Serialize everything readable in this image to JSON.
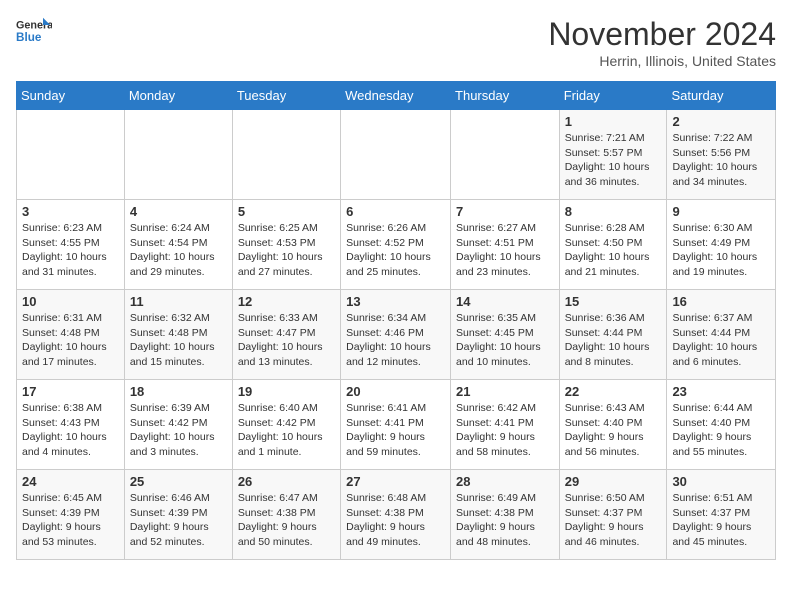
{
  "logo": {
    "line1": "General",
    "line2": "Blue"
  },
  "title": "November 2024",
  "location": "Herrin, Illinois, United States",
  "days_of_week": [
    "Sunday",
    "Monday",
    "Tuesday",
    "Wednesday",
    "Thursday",
    "Friday",
    "Saturday"
  ],
  "weeks": [
    [
      {
        "day": "",
        "info": ""
      },
      {
        "day": "",
        "info": ""
      },
      {
        "day": "",
        "info": ""
      },
      {
        "day": "",
        "info": ""
      },
      {
        "day": "",
        "info": ""
      },
      {
        "day": "1",
        "info": "Sunrise: 7:21 AM\nSunset: 5:57 PM\nDaylight: 10 hours and 36 minutes."
      },
      {
        "day": "2",
        "info": "Sunrise: 7:22 AM\nSunset: 5:56 PM\nDaylight: 10 hours and 34 minutes."
      }
    ],
    [
      {
        "day": "3",
        "info": "Sunrise: 6:23 AM\nSunset: 4:55 PM\nDaylight: 10 hours and 31 minutes."
      },
      {
        "day": "4",
        "info": "Sunrise: 6:24 AM\nSunset: 4:54 PM\nDaylight: 10 hours and 29 minutes."
      },
      {
        "day": "5",
        "info": "Sunrise: 6:25 AM\nSunset: 4:53 PM\nDaylight: 10 hours and 27 minutes."
      },
      {
        "day": "6",
        "info": "Sunrise: 6:26 AM\nSunset: 4:52 PM\nDaylight: 10 hours and 25 minutes."
      },
      {
        "day": "7",
        "info": "Sunrise: 6:27 AM\nSunset: 4:51 PM\nDaylight: 10 hours and 23 minutes."
      },
      {
        "day": "8",
        "info": "Sunrise: 6:28 AM\nSunset: 4:50 PM\nDaylight: 10 hours and 21 minutes."
      },
      {
        "day": "9",
        "info": "Sunrise: 6:30 AM\nSunset: 4:49 PM\nDaylight: 10 hours and 19 minutes."
      }
    ],
    [
      {
        "day": "10",
        "info": "Sunrise: 6:31 AM\nSunset: 4:48 PM\nDaylight: 10 hours and 17 minutes."
      },
      {
        "day": "11",
        "info": "Sunrise: 6:32 AM\nSunset: 4:48 PM\nDaylight: 10 hours and 15 minutes."
      },
      {
        "day": "12",
        "info": "Sunrise: 6:33 AM\nSunset: 4:47 PM\nDaylight: 10 hours and 13 minutes."
      },
      {
        "day": "13",
        "info": "Sunrise: 6:34 AM\nSunset: 4:46 PM\nDaylight: 10 hours and 12 minutes."
      },
      {
        "day": "14",
        "info": "Sunrise: 6:35 AM\nSunset: 4:45 PM\nDaylight: 10 hours and 10 minutes."
      },
      {
        "day": "15",
        "info": "Sunrise: 6:36 AM\nSunset: 4:44 PM\nDaylight: 10 hours and 8 minutes."
      },
      {
        "day": "16",
        "info": "Sunrise: 6:37 AM\nSunset: 4:44 PM\nDaylight: 10 hours and 6 minutes."
      }
    ],
    [
      {
        "day": "17",
        "info": "Sunrise: 6:38 AM\nSunset: 4:43 PM\nDaylight: 10 hours and 4 minutes."
      },
      {
        "day": "18",
        "info": "Sunrise: 6:39 AM\nSunset: 4:42 PM\nDaylight: 10 hours and 3 minutes."
      },
      {
        "day": "19",
        "info": "Sunrise: 6:40 AM\nSunset: 4:42 PM\nDaylight: 10 hours and 1 minute."
      },
      {
        "day": "20",
        "info": "Sunrise: 6:41 AM\nSunset: 4:41 PM\nDaylight: 9 hours and 59 minutes."
      },
      {
        "day": "21",
        "info": "Sunrise: 6:42 AM\nSunset: 4:41 PM\nDaylight: 9 hours and 58 minutes."
      },
      {
        "day": "22",
        "info": "Sunrise: 6:43 AM\nSunset: 4:40 PM\nDaylight: 9 hours and 56 minutes."
      },
      {
        "day": "23",
        "info": "Sunrise: 6:44 AM\nSunset: 4:40 PM\nDaylight: 9 hours and 55 minutes."
      }
    ],
    [
      {
        "day": "24",
        "info": "Sunrise: 6:45 AM\nSunset: 4:39 PM\nDaylight: 9 hours and 53 minutes."
      },
      {
        "day": "25",
        "info": "Sunrise: 6:46 AM\nSunset: 4:39 PM\nDaylight: 9 hours and 52 minutes."
      },
      {
        "day": "26",
        "info": "Sunrise: 6:47 AM\nSunset: 4:38 PM\nDaylight: 9 hours and 50 minutes."
      },
      {
        "day": "27",
        "info": "Sunrise: 6:48 AM\nSunset: 4:38 PM\nDaylight: 9 hours and 49 minutes."
      },
      {
        "day": "28",
        "info": "Sunrise: 6:49 AM\nSunset: 4:38 PM\nDaylight: 9 hours and 48 minutes."
      },
      {
        "day": "29",
        "info": "Sunrise: 6:50 AM\nSunset: 4:37 PM\nDaylight: 9 hours and 46 minutes."
      },
      {
        "day": "30",
        "info": "Sunrise: 6:51 AM\nSunset: 4:37 PM\nDaylight: 9 hours and 45 minutes."
      }
    ]
  ]
}
